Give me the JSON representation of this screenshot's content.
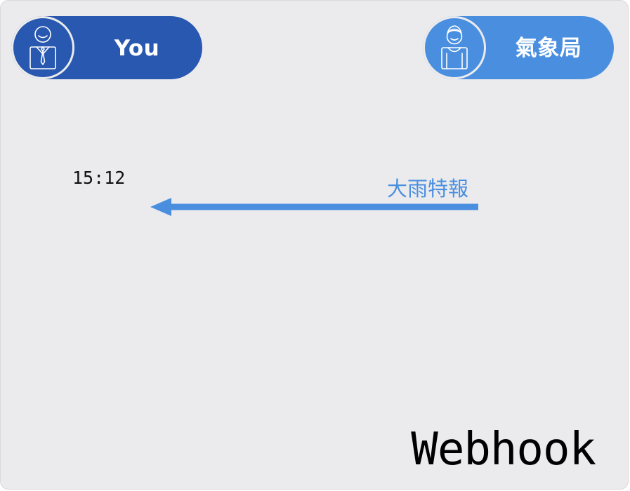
{
  "participants": {
    "you": {
      "label": "You",
      "icon": "male-user-icon",
      "color": "#2858b0"
    },
    "agency": {
      "label": "氣象局",
      "icon": "female-user-icon",
      "color": "#4a8fdf"
    }
  },
  "message": {
    "time": "15:12",
    "text": "大雨特報",
    "direction": "agency-to-you",
    "color": "#4a8fdf"
  },
  "footer": {
    "label": "Webhook"
  }
}
